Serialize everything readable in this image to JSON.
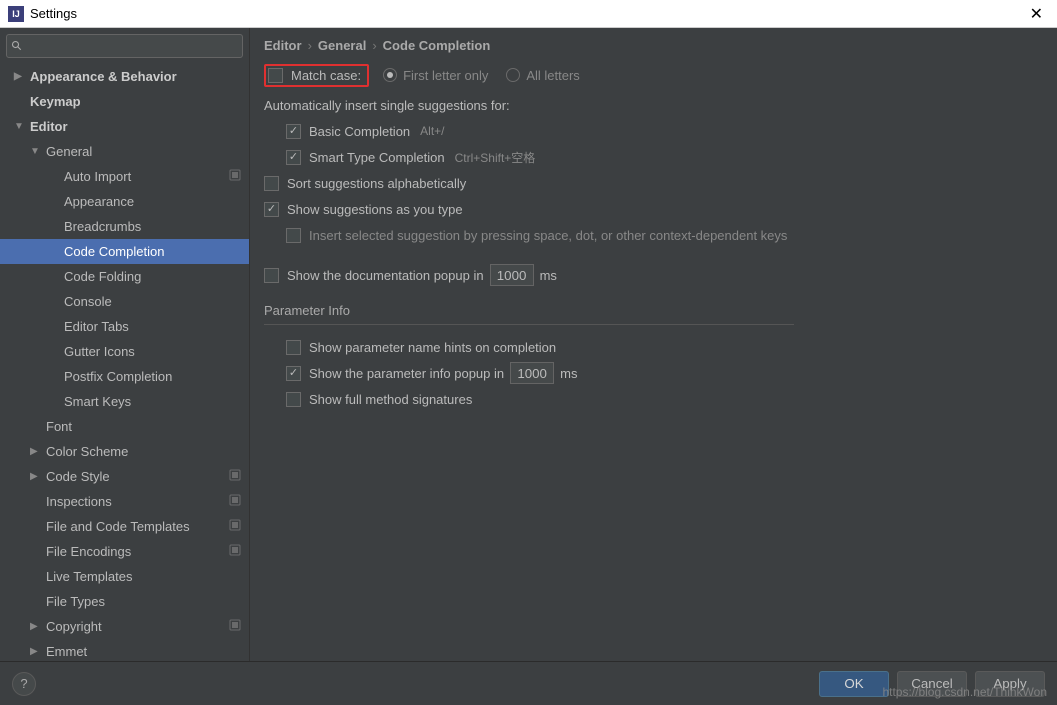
{
  "window": {
    "title": "Settings"
  },
  "breadcrumb": {
    "p1": "Editor",
    "p2": "General",
    "p3": "Code Completion"
  },
  "sidebar": {
    "items": [
      {
        "label": "Appearance & Behavior",
        "level": 0,
        "arrow": "▶"
      },
      {
        "label": "Keymap",
        "level": 0,
        "arrow": ""
      },
      {
        "label": "Editor",
        "level": 0,
        "arrow": "▼"
      },
      {
        "label": "General",
        "level": 1,
        "arrow": "▼"
      },
      {
        "label": "Auto Import",
        "level": 2,
        "badge": true
      },
      {
        "label": "Appearance",
        "level": 2
      },
      {
        "label": "Breadcrumbs",
        "level": 2
      },
      {
        "label": "Code Completion",
        "level": 2,
        "selected": true
      },
      {
        "label": "Code Folding",
        "level": 2
      },
      {
        "label": "Console",
        "level": 2
      },
      {
        "label": "Editor Tabs",
        "level": 2
      },
      {
        "label": "Gutter Icons",
        "level": 2
      },
      {
        "label": "Postfix Completion",
        "level": 2
      },
      {
        "label": "Smart Keys",
        "level": 2
      },
      {
        "label": "Font",
        "level": 1
      },
      {
        "label": "Color Scheme",
        "level": 1,
        "arrow": "▶"
      },
      {
        "label": "Code Style",
        "level": 1,
        "arrow": "▶",
        "badge": true
      },
      {
        "label": "Inspections",
        "level": 1,
        "badge": true
      },
      {
        "label": "File and Code Templates",
        "level": 1,
        "badge": true
      },
      {
        "label": "File Encodings",
        "level": 1,
        "badge": true
      },
      {
        "label": "Live Templates",
        "level": 1
      },
      {
        "label": "File Types",
        "level": 1
      },
      {
        "label": "Copyright",
        "level": 1,
        "arrow": "▶",
        "badge": true
      },
      {
        "label": "Emmet",
        "level": 1,
        "arrow": "▶"
      }
    ]
  },
  "opts": {
    "match_case": "Match case:",
    "first_letter": "First letter only",
    "all_letters": "All letters",
    "auto_insert_header": "Automatically insert single suggestions for:",
    "basic": "Basic Completion",
    "basic_kb": "Alt+/",
    "smart": "Smart Type Completion",
    "smart_kb": "Ctrl+Shift+空格",
    "sort_alpha": "Sort suggestions alphabetically",
    "show_type": "Show suggestions as you type",
    "insert_space": "Insert selected suggestion by pressing space, dot, or other context-dependent keys",
    "show_doc": "Show the documentation popup in",
    "doc_ms": "1000",
    "ms": "ms",
    "param_header": "Parameter Info",
    "param_hints": "Show parameter name hints on completion",
    "param_popup": "Show the parameter info popup in",
    "param_ms": "1000",
    "full_sig": "Show full method signatures"
  },
  "buttons": {
    "ok": "OK",
    "cancel": "Cancel",
    "apply": "Apply"
  },
  "watermark": "https://blog.csdn.net/ThinkWon"
}
